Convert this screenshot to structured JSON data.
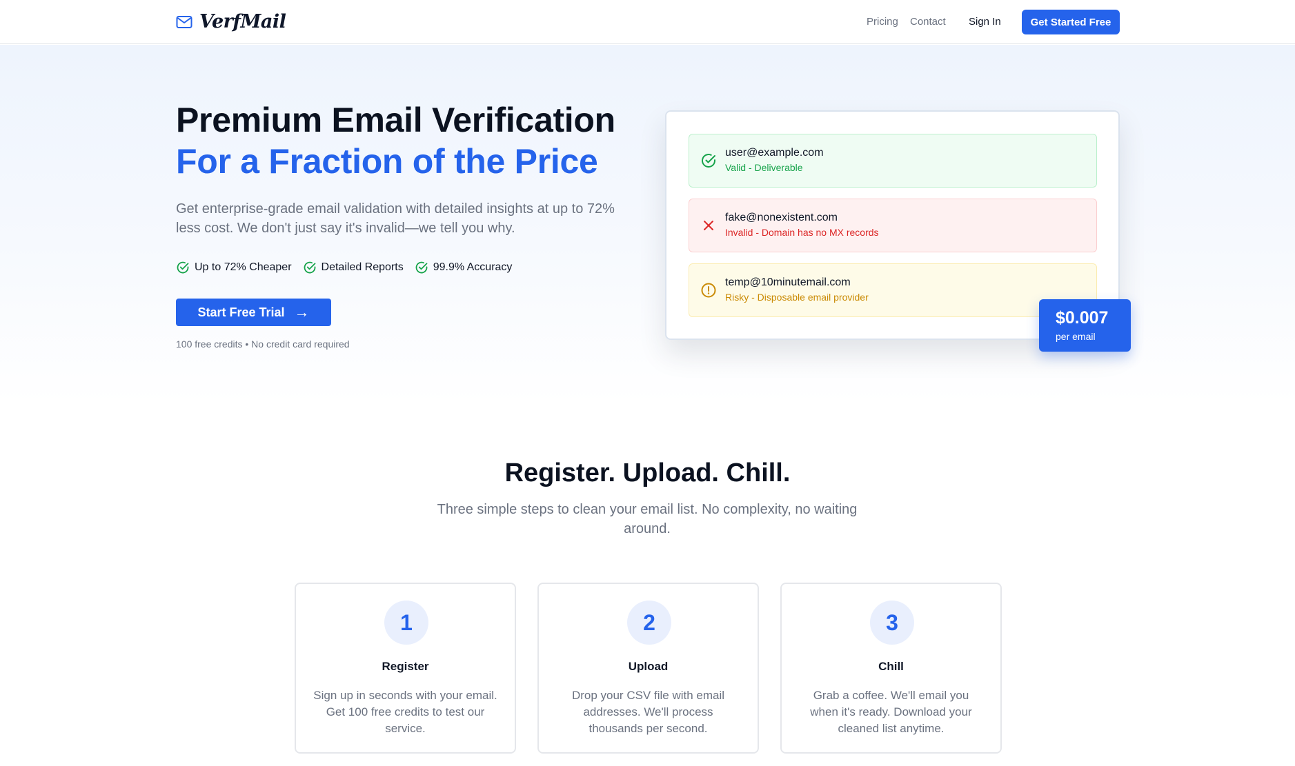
{
  "nav": {
    "brand": "VerfMail",
    "links": [
      "Pricing",
      "Contact"
    ],
    "sign_in": "Sign In",
    "cta": "Get Started Free"
  },
  "hero": {
    "title_line1": "Premium Email Verification",
    "title_line2": "For a Fraction of the Price",
    "subtitle": "Get enterprise-grade email validation with detailed insights at up to 72% less cost. We don't just say it's invalid—we tell you why.",
    "features": [
      "Up to 72% Cheaper",
      "Detailed Reports",
      "99.9% Accuracy"
    ],
    "cta": "Start Free Trial",
    "cta_arrow": "→",
    "note": "100 free credits • No credit card required"
  },
  "demo": {
    "results": [
      {
        "email": "user@example.com",
        "status": "Valid - Deliverable",
        "icon": "check-circle-icon"
      },
      {
        "email": "fake@nonexistent.com",
        "status": "Invalid - Domain has no MX records",
        "icon": "x-icon"
      },
      {
        "email": "temp@10minutemail.com",
        "status": "Risky - Disposable email provider",
        "icon": "alert-circle-icon"
      }
    ],
    "price": "$0.007",
    "price_unit": "per email"
  },
  "steps": {
    "title": "Register. Upload. Chill.",
    "subtitle": "Three simple steps to clean your email list. No complexity, no waiting around.",
    "items": [
      {
        "number": "1",
        "title": "Register",
        "description": "Sign up in seconds with your email. Get 100 free credits to test our service."
      },
      {
        "number": "2",
        "title": "Upload",
        "description": "Drop your CSV file with email addresses. We'll process thousands per second."
      },
      {
        "number": "3",
        "title": "Chill",
        "description": "Grab a coffee. We'll email you when it's ready. Download your cleaned list anytime."
      }
    ]
  },
  "colors": {
    "accent": "#2563eb",
    "valid": "#16a34a",
    "invalid": "#dc2626",
    "risky": "#ca8a04"
  }
}
